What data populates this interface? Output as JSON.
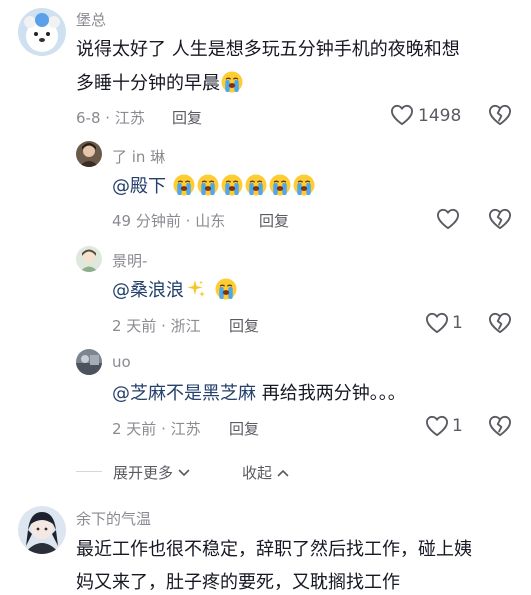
{
  "comments": [
    {
      "username": "堡总",
      "text_line1": "说得太好了 人生是想多玩五分钟手机的夜晚和想",
      "text_line2": "多睡十分钟的早晨",
      "date": "6-8",
      "location": "江苏",
      "reply_label": "回复",
      "like_count": "1498"
    },
    {
      "username": "了 in 琳",
      "mention": "@殿下",
      "time": "49 分钟前",
      "location": "山东",
      "reply_label": "回复"
    },
    {
      "username": "景明-",
      "mention": "@桑浪浪",
      "time": "2 天前",
      "location": "浙江",
      "reply_label": "回复",
      "like_count": "1"
    },
    {
      "username": "uo",
      "mention": "@芝麻不是黑芝麻",
      "text": "再给我两分钟。。。",
      "time": "2 天前",
      "location": "江苏",
      "reply_label": "回复",
      "like_count": "1"
    },
    {
      "username": "余下的气温",
      "text_line1": "最近工作也很不稳定，辞职了然后找工作，碰上姨",
      "text_line2": "妈又来了，肚子疼的要死，又耽搁找工作"
    }
  ],
  "controls": {
    "expand_more": "展开更多",
    "collapse": "收起"
  },
  "separator": "·",
  "icons": {
    "like": "heart-outline-icon",
    "dislike": "broken-heart-icon",
    "cry_emoji": "loudly-crying-face-emoji",
    "sparkle": "sparkles-emoji"
  },
  "colors": {
    "mention": "#25406b",
    "secondary_text": "#8a8b91",
    "primary_text": "#161823"
  }
}
